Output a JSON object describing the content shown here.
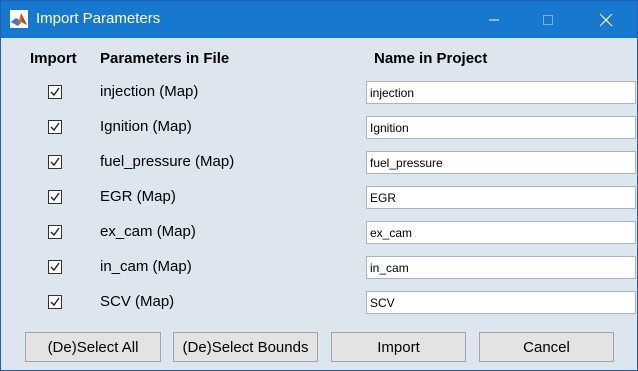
{
  "window": {
    "title": "Import Parameters"
  },
  "titlebar_icons": {
    "app": "matlab-logo-icon",
    "minimize": "minimize-icon",
    "maximize": "maximize-icon",
    "close": "close-icon"
  },
  "headers": {
    "import": "Import",
    "file": "Parameters in File",
    "project": "Name in Project"
  },
  "rows": [
    {
      "checked": true,
      "file_name": "injection (Map)",
      "project_name": "injection"
    },
    {
      "checked": true,
      "file_name": "Ignition (Map)",
      "project_name": "Ignition"
    },
    {
      "checked": true,
      "file_name": "fuel_pressure (Map)",
      "project_name": "fuel_pressure"
    },
    {
      "checked": true,
      "file_name": "EGR (Map)",
      "project_name": "EGR"
    },
    {
      "checked": true,
      "file_name": "ex_cam (Map)",
      "project_name": "ex_cam"
    },
    {
      "checked": true,
      "file_name": "in_cam (Map)",
      "project_name": "in_cam"
    },
    {
      "checked": true,
      "file_name": "SCV (Map)",
      "project_name": "SCV"
    }
  ],
  "buttons": {
    "select_all": "(De)Select All",
    "select_bounds": "(De)Select Bounds",
    "import": "Import",
    "cancel": "Cancel"
  },
  "colors": {
    "titlebar": "#1778d0",
    "panel": "#dde5ef",
    "button": "#e3e3e3"
  }
}
